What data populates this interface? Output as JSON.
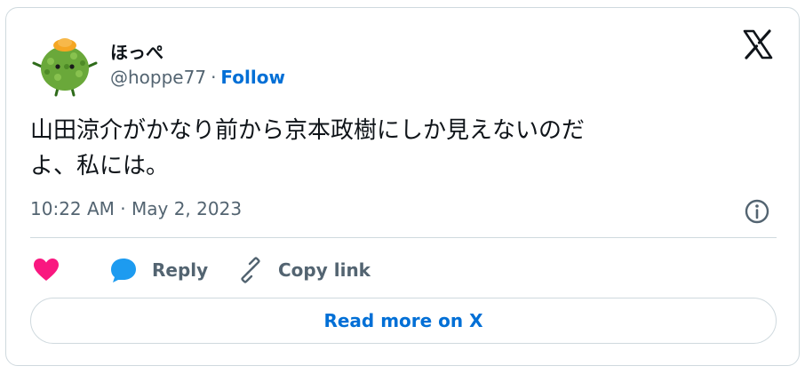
{
  "author": {
    "display_name": "ほっぺ",
    "handle": "@hoppe77",
    "separator": "·",
    "follow_label": "Follow"
  },
  "tweet": {
    "text": "山田涼介がかなり前から京本政樹にしか見えないのだ\nよ、私には。",
    "timestamp": "10:22 AM · May 2, 2023"
  },
  "actions": {
    "reply_label": "Reply",
    "copy_link_label": "Copy link"
  },
  "read_more_label": "Read more on X",
  "colors": {
    "link": "#006fd6",
    "like": "#f91880",
    "reply": "#1d9bf0",
    "secondary_text": "#536471",
    "border": "#cfd9de"
  },
  "icons": [
    "x-logo-icon",
    "info-icon",
    "heart-icon",
    "reply-bubble-icon",
    "link-icon"
  ]
}
